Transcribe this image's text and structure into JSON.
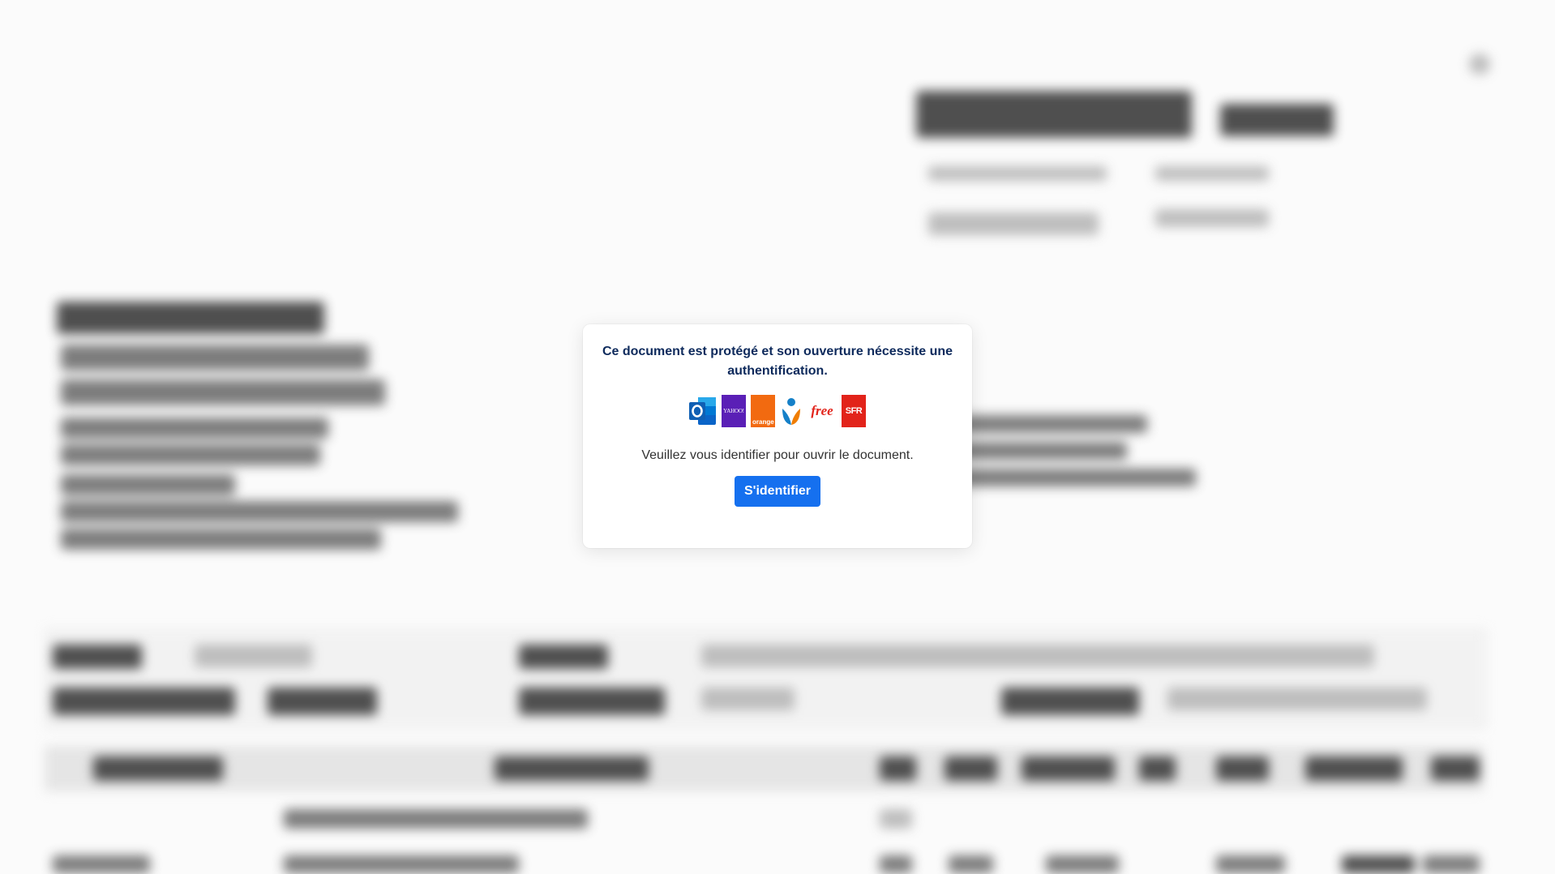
{
  "modal": {
    "message": "Ce document est protégé et son ouverture nécessite une authentification.",
    "instruction": "Veuillez vous identifier pour ouvrir le document.",
    "login_label": "S'identifier",
    "providers": [
      {
        "name": "Outlook",
        "icon": "outlook-logo",
        "color": "#0a64c8"
      },
      {
        "name": "Yahoo",
        "icon": "yahoo-logo",
        "label": "YAHOO!",
        "color": "#5a1fb6"
      },
      {
        "name": "Orange",
        "icon": "orange-logo",
        "label": "orange",
        "color": "#f26a10"
      },
      {
        "name": "Bouygues",
        "icon": "bouygues-logo",
        "color": "#1580c8"
      },
      {
        "name": "Free",
        "icon": "free-logo",
        "label": "free",
        "color": "#e2231a"
      },
      {
        "name": "SFR",
        "icon": "sfr-logo",
        "label": "SFR",
        "color": "#e2231a"
      }
    ]
  },
  "colors": {
    "button": "#1570ef",
    "message_text": "#0e2a5c",
    "backdrop": "#fbfbfb"
  }
}
